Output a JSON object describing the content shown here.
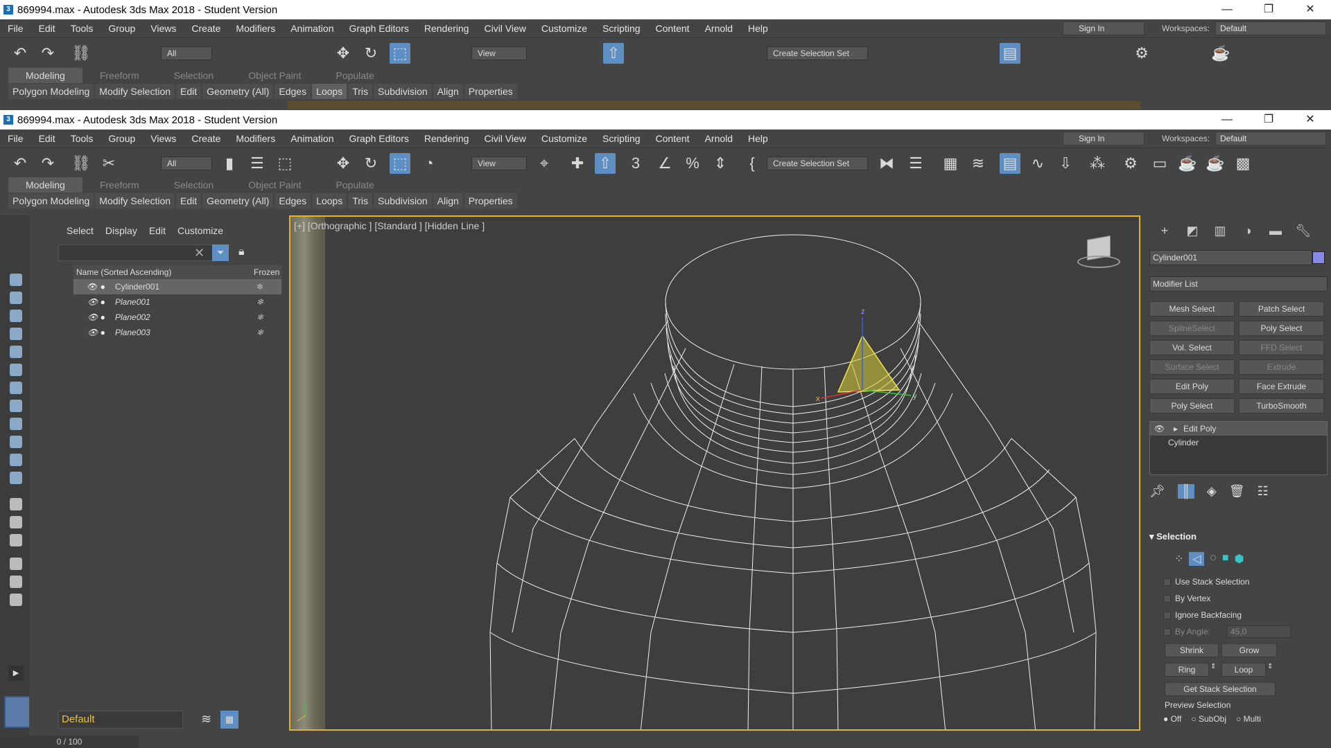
{
  "window": {
    "title": "869994.max - Autodesk 3ds Max 2018 - Student Version",
    "app_icon": "3",
    "controls": [
      "—",
      "❐",
      "✕"
    ]
  },
  "menu": [
    "File",
    "Edit",
    "Tools",
    "Group",
    "Views",
    "Create",
    "Modifiers",
    "Animation",
    "Graph Editors",
    "Rendering",
    "Civil View",
    "Customize",
    "Scripting",
    "Content",
    "Arnold",
    "Help"
  ],
  "account": {
    "sign_in": "Sign In",
    "workspaces_label": "Workspaces:",
    "workspace": "Default"
  },
  "toolbar": {
    "filter": "All",
    "view": "View",
    "selection_set": "Create Selection Set"
  },
  "ribbon": {
    "tabs": [
      "Modeling",
      "Freeform",
      "Selection",
      "Object Paint",
      "Populate"
    ],
    "sub": [
      "Polygon Modeling",
      "Modify Selection",
      "Edit",
      "Geometry (All)",
      "Edges",
      "Loops",
      "Tris",
      "Subdivision",
      "Align",
      "Properties"
    ]
  },
  "explorer": {
    "menu": [
      "Select",
      "Display",
      "Edit",
      "Customize"
    ],
    "col_name": "Name (Sorted Ascending)",
    "col_frozen": "Frozen",
    "rows": [
      "Cylinder001",
      "Plane001",
      "Plane002",
      "Plane003"
    ],
    "layer": "Default"
  },
  "viewport": {
    "label": "[+] [Orthographic ] [Standard ] [Hidden Line ]"
  },
  "command_panel": {
    "object_name": "Cylinder001",
    "object_color": "#8888e6",
    "modifier_list": "Modifier List",
    "modifier_buttons": [
      "Mesh Select",
      "Patch Select",
      "SplineSelect",
      "Poly Select",
      "Vol. Select",
      "FFD Select",
      "Surface Select",
      "Extrude",
      "Edit Poly",
      "Face Extrude",
      "Poly Select",
      "TurboSmooth"
    ],
    "stack": [
      "Edit Poly",
      "Cylinder"
    ],
    "selection": {
      "title": "Selection",
      "options": [
        "Use Stack Selection",
        "By Vertex",
        "Ignore Backfacing",
        "By Angle:"
      ],
      "angle": "45,0",
      "buttons": [
        "Shrink",
        "Grow",
        "Ring",
        "Loop",
        "Get Stack Selection"
      ],
      "preview_label": "Preview Selection",
      "preview_options": [
        "Off",
        "SubObj",
        "Multi"
      ]
    }
  },
  "timeline": {
    "frame": "0 / 100"
  }
}
